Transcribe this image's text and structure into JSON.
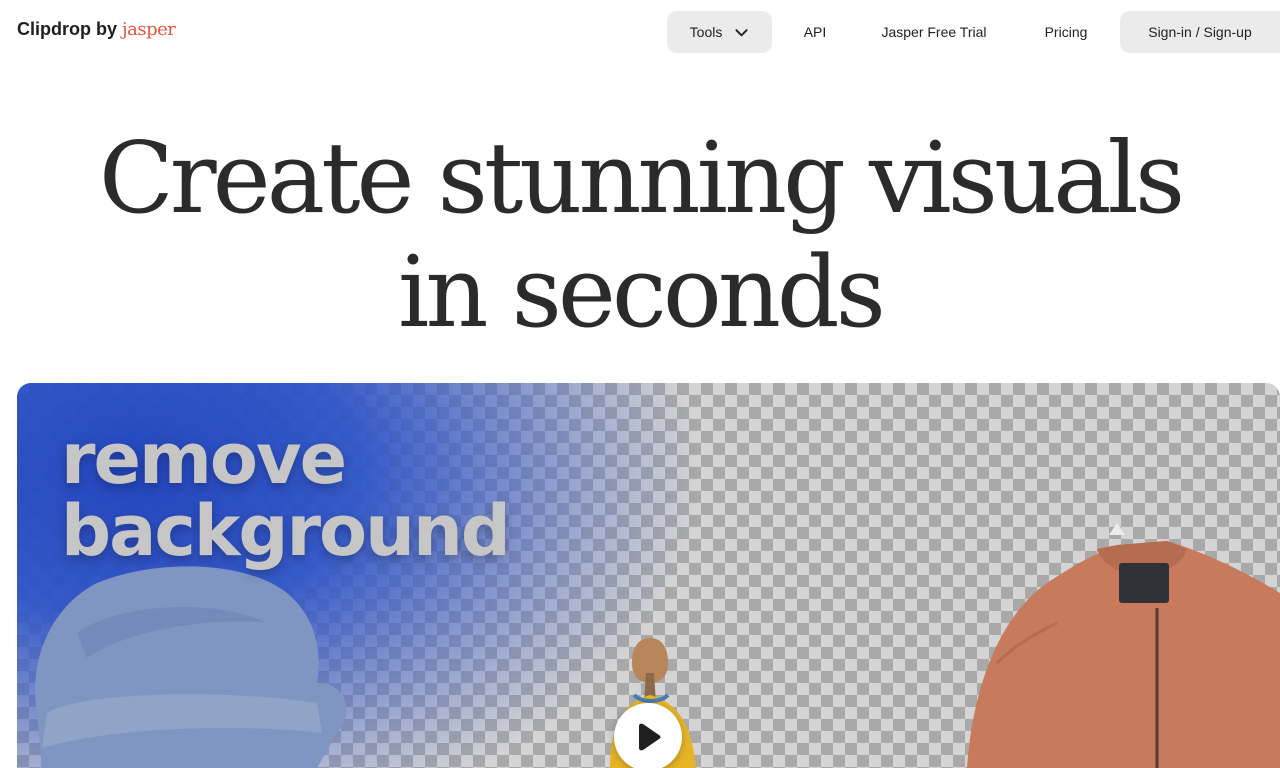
{
  "header": {
    "logo": {
      "main": "Clipdrop",
      "by": "by",
      "brand": "jasper",
      "brand_color": "#e8543e"
    },
    "nav": {
      "tools_label": "Tools",
      "tools_icon": "chevron-down-icon",
      "api_label": "API",
      "trial_label": "Jasper Free Trial",
      "pricing_label": "Pricing",
      "signin_label": "Sign-in / Sign-up"
    }
  },
  "hero": {
    "title_line1": "Create stunning visuals",
    "title_line2": "in seconds"
  },
  "media": {
    "overlay_line1": "remove",
    "overlay_line2": "background",
    "play_icon": "play-icon",
    "accent_color": "#2a4cc4"
  }
}
